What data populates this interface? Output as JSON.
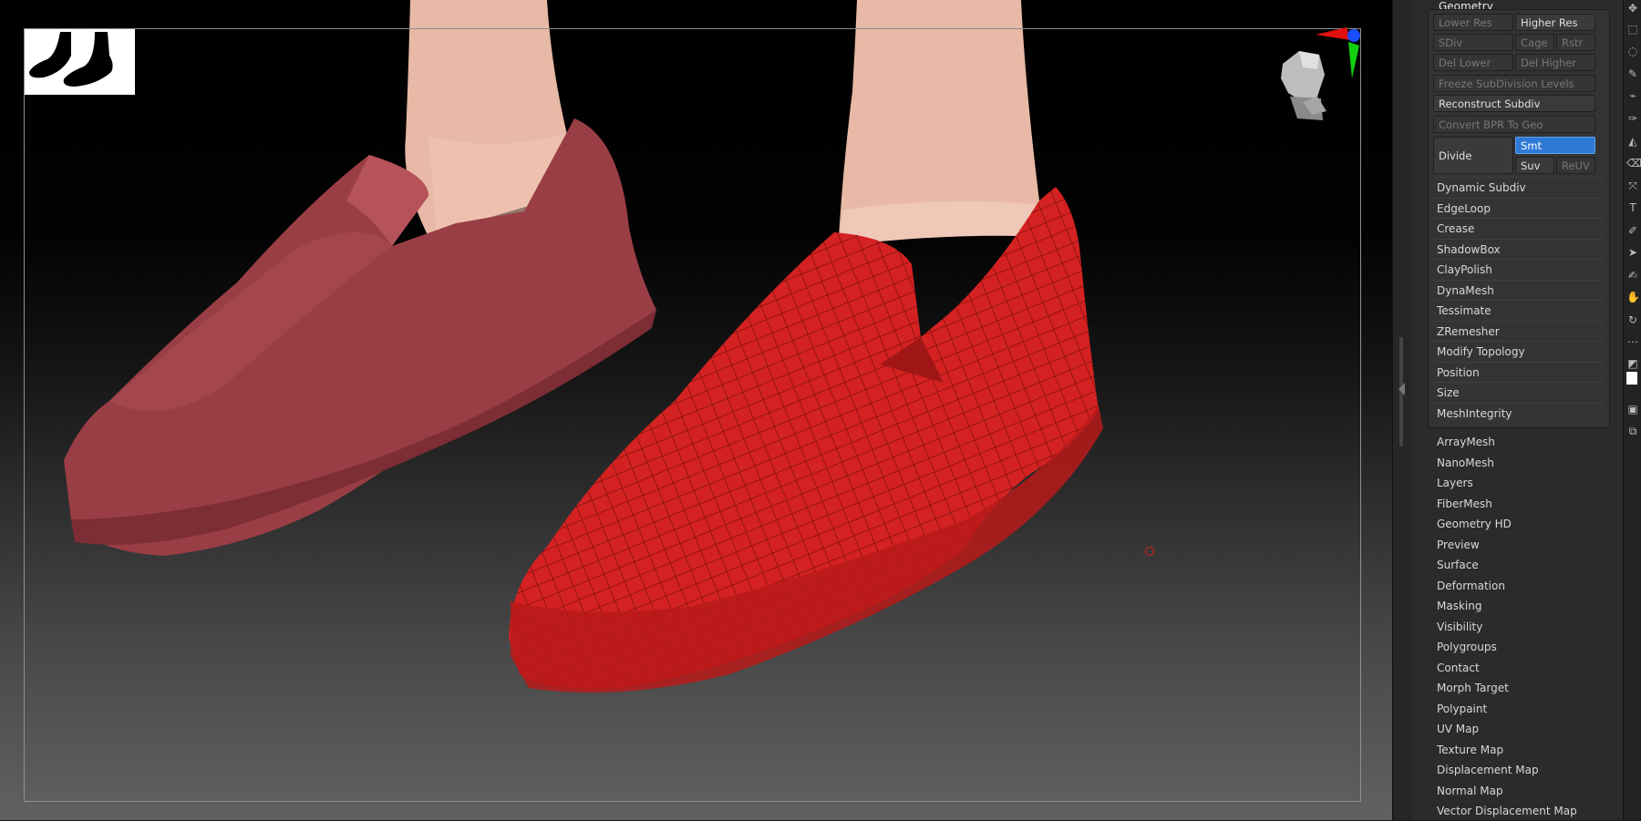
{
  "panel": {
    "section_title": "Geometry",
    "geometry": {
      "lower_res": "Lower Res",
      "higher_res": "Higher Res",
      "sdiv": "SDiv",
      "cage": "Cage",
      "rstr": "Rstr",
      "del_lower": "Del Lower",
      "del_higher": "Del Higher",
      "freeze": "Freeze SubDivision Levels",
      "reconstruct": "Reconstruct Subdiv",
      "convert_bpr": "Convert BPR To Geo",
      "divide": "Divide",
      "smt": "Smt",
      "suv": "Suv",
      "reuv": "ReUV",
      "subpalettes": [
        "Dynamic Subdiv",
        "EdgeLoop",
        "Crease",
        "ShadowBox",
        "ClayPolish",
        "DynaMesh",
        "Tessimate",
        "ZRemesher",
        "Modify Topology",
        "Position",
        "Size",
        "MeshIntegrity"
      ]
    },
    "tool_subpalettes": [
      "ArrayMesh",
      "NanoMesh",
      "Layers",
      "FiberMesh",
      "Geometry HD",
      "Preview",
      "Surface",
      "Deformation",
      "Masking",
      "Visibility",
      "Polygroups",
      "Contact",
      "Morph Target",
      "Polypaint",
      "UV Map",
      "Texture Map",
      "Displacement Map",
      "Normal Map",
      "Vector Displacement Map"
    ]
  },
  "colors": {
    "selected_button": "#2f7ad6",
    "slider_green": "#4caf3a",
    "mesh_red": "#d42121",
    "shoe_dim": "#9a3e45",
    "skin": "#e8b9a6"
  },
  "toolbar_icons": [
    "move-icon",
    "select-rect-icon",
    "lasso-icon",
    "pen-icon",
    "brush-icon",
    "smooth-icon",
    "clay-icon",
    "eraser-icon",
    "transform-icon",
    "text-icon",
    "paint-icon",
    "cursor-icon",
    "edit-icon",
    "hand-icon",
    "rotate-icon",
    "more-icon",
    "swatch-icon",
    "white-color-icon",
    "layers-icon",
    "copy-icon"
  ]
}
